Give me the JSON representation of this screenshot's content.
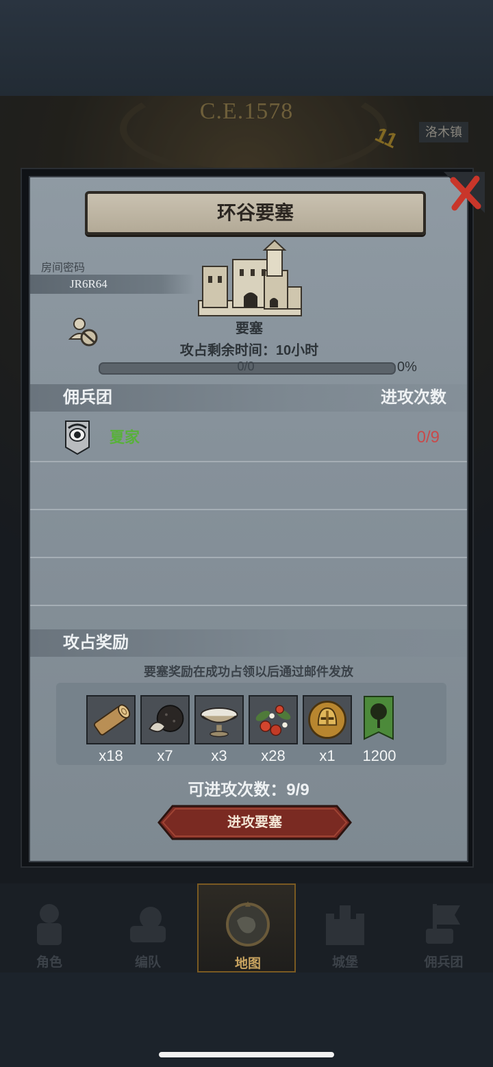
{
  "background": {
    "era": "C.E.1578",
    "hour": "11",
    "town_label": "洛木镇"
  },
  "dialog": {
    "title": "环谷要塞",
    "close_icon": "close-x-icon",
    "room_label": "房间密码",
    "room_code": "JR6R64",
    "building_label": "要塞",
    "time_left": "攻占剩余时间：10小时",
    "progress": {
      "text": "0/0",
      "percent_text": "0%",
      "fraction": 0
    },
    "mercenary_header": {
      "left": "佣兵团",
      "right": "进攻次数"
    },
    "mercenaries": [
      {
        "name": "夏家",
        "count": "0/9"
      }
    ],
    "rewards_header": "攻占奖励",
    "rewards_note": "要塞奖励在成功占领以后通过邮件发放",
    "rewards": [
      {
        "icon": "wood-log-icon",
        "qty": "x18"
      },
      {
        "icon": "truffle-icon",
        "qty": "x7"
      },
      {
        "icon": "salt-bowl-icon",
        "qty": "x3"
      },
      {
        "icon": "berries-icon",
        "qty": "x28"
      },
      {
        "icon": "gold-helmet-icon",
        "qty": "x1"
      },
      {
        "icon": "tree-banner-icon",
        "qty": "1200"
      }
    ],
    "attempts": "可进攻次数：9/9",
    "attack_button": "进攻要塞"
  },
  "nav": [
    {
      "label": "角色",
      "icon": "knight-icon"
    },
    {
      "label": "编队",
      "icon": "formation-icon"
    },
    {
      "label": "地图",
      "icon": "compass-map-icon",
      "active": true
    },
    {
      "label": "城堡",
      "icon": "castle-icon"
    },
    {
      "label": "佣兵团",
      "icon": "mercenary-icon"
    }
  ],
  "colors": {
    "merc_name": "#58b13a",
    "merc_count": "#c84a4a",
    "attack_button": "#7a2a22"
  }
}
